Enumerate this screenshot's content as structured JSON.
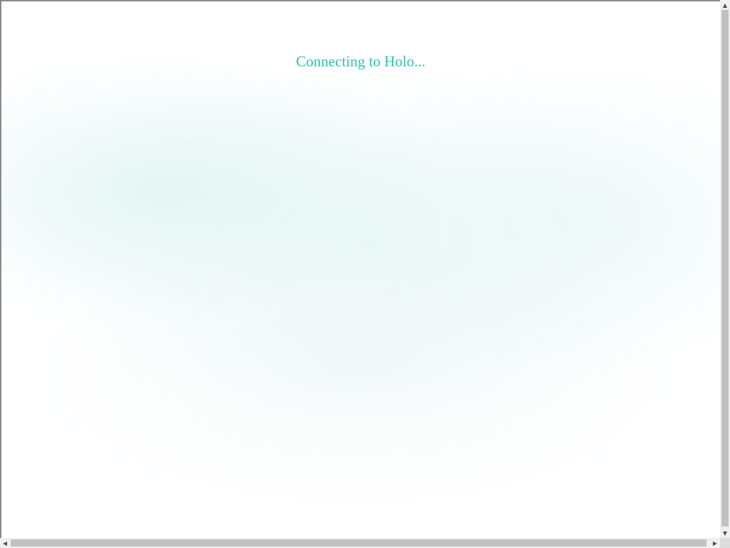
{
  "status": {
    "message": "Connecting to Holo..."
  },
  "colors": {
    "accent": "#2ec4b0",
    "background": "#ffffff",
    "scrollbar_thumb": "#c1c1c1",
    "scrollbar_track": "#f0f0f0"
  },
  "scrollbars": {
    "vertical": {
      "up_icon": "triangle-up-icon",
      "down_icon": "triangle-down-icon"
    },
    "horizontal": {
      "left_icon": "triangle-left-icon",
      "right_icon": "triangle-right-icon"
    }
  }
}
